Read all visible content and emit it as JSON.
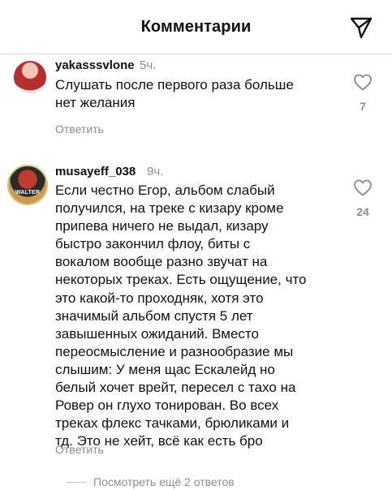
{
  "header": {
    "title": "Комментарии",
    "send_icon": "send-icon"
  },
  "comments": [
    {
      "username": "yakasssvlone",
      "time": "5ч.",
      "text": "Слушать после первого раза больше\nнет желания",
      "likes": "7",
      "reply_label": "Ответить"
    },
    {
      "username": "musayeff_038",
      "time": "9ч.",
      "avatar_text": "WALTER",
      "text": "Если честно Егор, альбом слабый\nполучился, на треке с кизару кроме\nприпева ничего не выдал, кизару\nбыстро закончил флоу, биты с\nвокалом вообще разно звучат на\nнекоторых треках. Есть ощущение, что\nэто какой-то проходняк, хотя это\nзначимый альбом спустя 5 лет\nзавышенных ожиданий. Вместо\nпереосмысление и разнообразие мы\nслышим: У меня щас Ескалейд но\nбелый хочет врейт, пересел с тахо на\nРовер он глухо тонирован. Во всех\nтреках флекс тачками, брюликами и\nтд. Это не хейт, всё как есть бро",
      "likes": "24",
      "reply_label": "Ответить",
      "view_replies": "Посмотреть ещё 2 ответов"
    }
  ],
  "colors": {
    "text": "#111111",
    "secondary": "#8e8e8e",
    "divider": "#dbdbdb"
  }
}
